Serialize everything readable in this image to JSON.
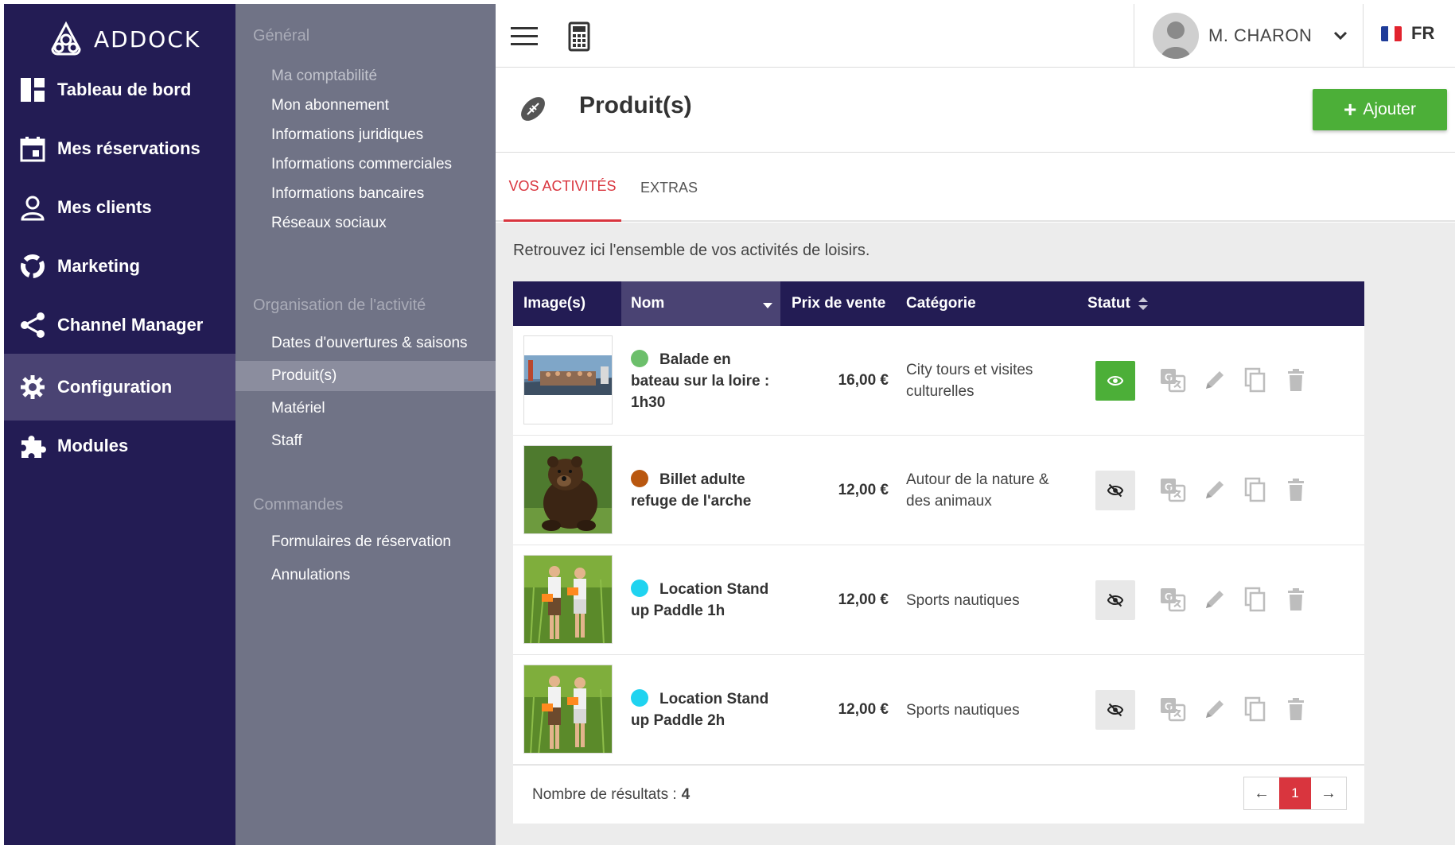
{
  "brand": {
    "name": "ADDOCK"
  },
  "sidebar": {
    "items": [
      {
        "label": "Tableau de bord",
        "icon": "dashboard-icon"
      },
      {
        "label": "Mes réservations",
        "icon": "calendar-icon"
      },
      {
        "label": "Mes clients",
        "icon": "user-icon"
      },
      {
        "label": "Marketing",
        "icon": "marketing-icon"
      },
      {
        "label": "Channel Manager",
        "icon": "share-icon"
      },
      {
        "label": "Configuration",
        "icon": "gear-icon",
        "active": true
      },
      {
        "label": "Modules",
        "icon": "puzzle-icon"
      }
    ]
  },
  "submenu": {
    "general": {
      "heading": "Général",
      "items": [
        "Ma comptabilité",
        "Mon abonnement",
        "Informations juridiques",
        "Informations commerciales",
        "Informations bancaires",
        "Réseaux sociaux"
      ]
    },
    "organisation": {
      "heading": "Organisation de l'activité",
      "items": [
        "Dates d'ouvertures & saisons",
        "Produit(s)",
        "Matériel",
        "Staff"
      ]
    },
    "commandes": {
      "heading": "Commandes",
      "items": [
        "Formulaires de réservation",
        "Annulations"
      ]
    }
  },
  "topbar": {
    "user_name": "M. CHARON",
    "language": "FR"
  },
  "page": {
    "title": "Produit(s)",
    "add_label": "Ajouter",
    "add_symbol": "+",
    "tabs": [
      "VOS ACTIVITÉS",
      "EXTRAS"
    ],
    "intro": "Retrouvez ici l'ensemble de vos activités de loisirs."
  },
  "table": {
    "headers": [
      "Image(s)",
      "Nom",
      "Prix de vente",
      "Catégorie",
      "Statut"
    ],
    "rows": [
      {
        "name": "Balade en bateau sur la loire : 1h30",
        "price": "16,00 €",
        "category": "City tours et visites culturelles",
        "dot_color": "#6cbf6b",
        "status": "visible",
        "image": "boat"
      },
      {
        "name": "Billet adulte refuge de l'arche",
        "price": "12,00 €",
        "category": "Autour de la nature & des animaux",
        "dot_color": "#b9570f",
        "status": "hidden",
        "image": "bear"
      },
      {
        "name": "Location Stand up Paddle 1h",
        "price": "12,00 €",
        "category": "Sports nautiques",
        "dot_color": "#1fd3f0",
        "status": "hidden",
        "image": "paddle"
      },
      {
        "name": "Location Stand up Paddle 2h",
        "price": "12,00 €",
        "category": "Sports nautiques",
        "dot_color": "#1fd3f0",
        "status": "hidden",
        "image": "paddle"
      }
    ],
    "results_label": "Nombre de résultats :",
    "results_count": "4",
    "pager": {
      "prev": "←",
      "current": "1",
      "next": "→"
    }
  },
  "colors": {
    "sidebar_bg": "#231c54",
    "submenu_bg": "#707386",
    "accent_red": "#d9353e",
    "add_green": "#4caf38"
  }
}
